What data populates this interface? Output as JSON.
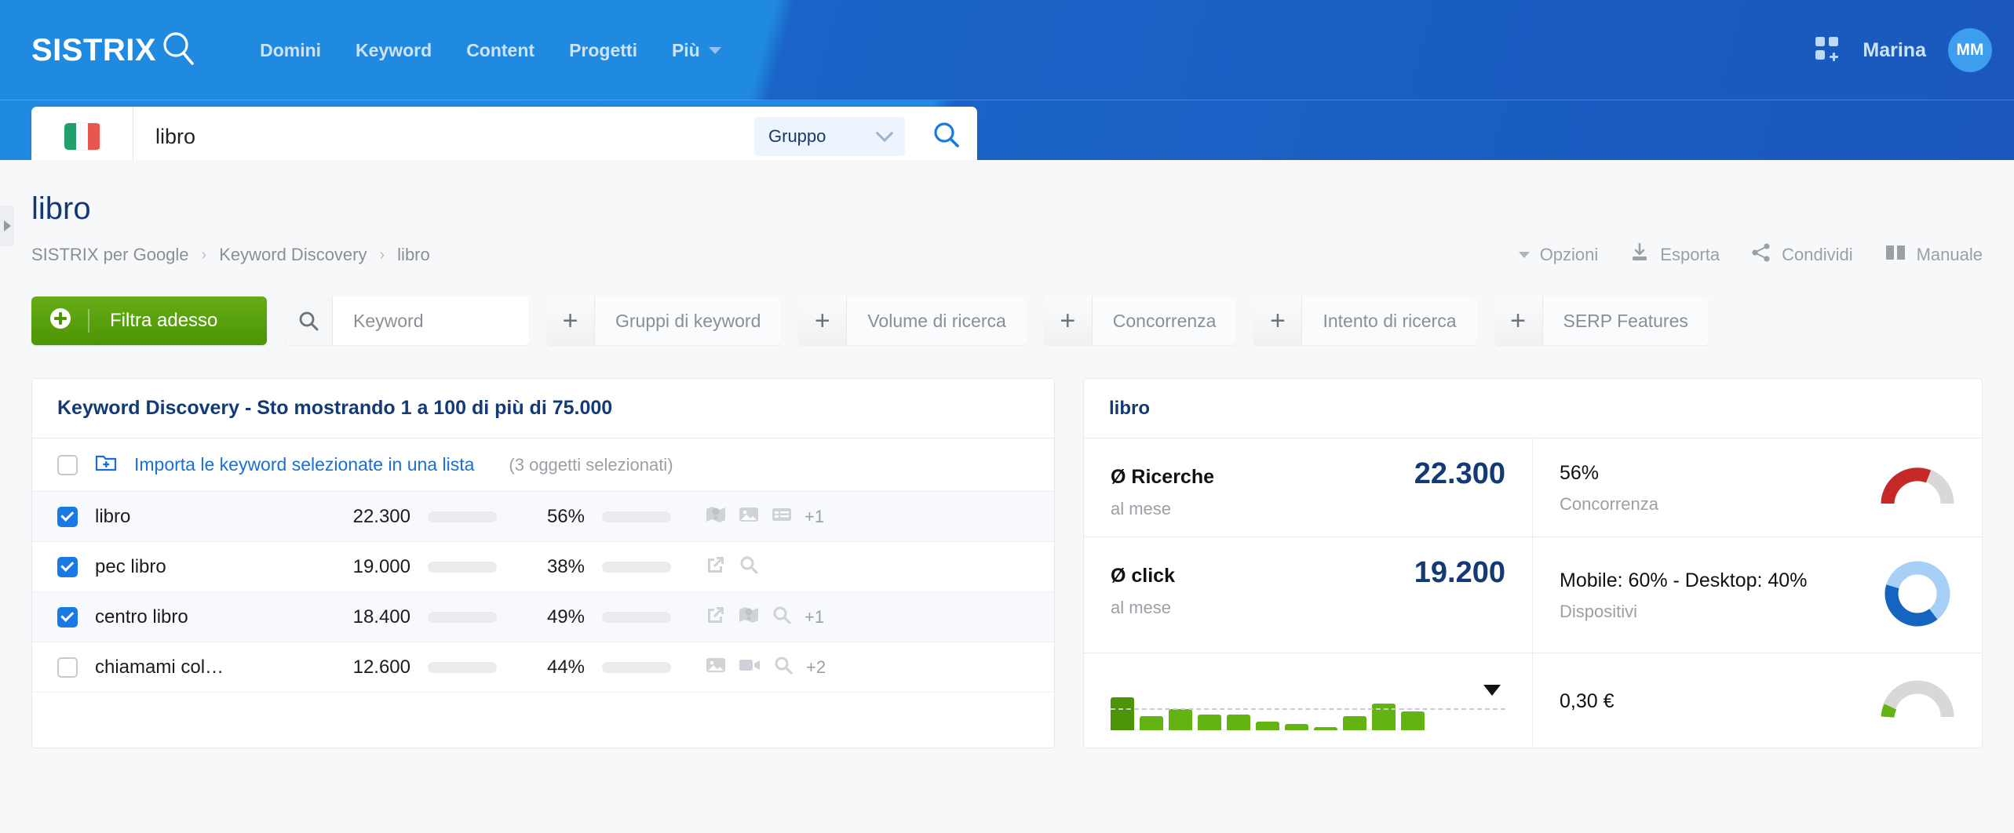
{
  "brand": {
    "name": "SISTRIX",
    "logo_icon": "magnifier-icon"
  },
  "nav": {
    "items": [
      {
        "label": "Domini"
      },
      {
        "label": "Keyword"
      },
      {
        "label": "Content"
      },
      {
        "label": "Progetti"
      },
      {
        "label": "Più",
        "has_caret": true
      }
    ]
  },
  "header_right": {
    "apps_icon": "apps-grid-plus-icon",
    "user_name": "Marina",
    "avatar_initials": "MM"
  },
  "search": {
    "country_flag": "italy-flag-icon",
    "value": "libro",
    "placeholder": "",
    "group_label": "Gruppo",
    "submit_icon": "search-icon"
  },
  "page": {
    "title": "libro",
    "breadcrumb": [
      {
        "label": "SISTRIX per Google"
      },
      {
        "label": "Keyword Discovery"
      },
      {
        "label": "libro"
      }
    ],
    "separator": "›",
    "actions": [
      {
        "label": "Opzioni",
        "icon": "caret-down-icon"
      },
      {
        "label": "Esporta",
        "icon": "download-icon"
      },
      {
        "label": "Condividi",
        "icon": "share-icon"
      },
      {
        "label": "Manuale",
        "icon": "book-icon"
      }
    ]
  },
  "filters": {
    "primary_button": {
      "label": "Filtra adesso",
      "icon": "plus-circle-icon"
    },
    "keyword_input": {
      "placeholder": "Keyword",
      "icon": "search-icon",
      "value": ""
    },
    "chips": [
      {
        "label": "Gruppi di keyword",
        "icon": "plus-icon"
      },
      {
        "label": "Volume di ricerca",
        "icon": "plus-icon"
      },
      {
        "label": "Concorrenza",
        "icon": "plus-icon"
      },
      {
        "label": "Intento di ricerca",
        "icon": "plus-icon"
      },
      {
        "label": "SERP Features",
        "icon": "plus-icon"
      }
    ]
  },
  "results": {
    "title": "Keyword Discovery - Sto mostrando 1 a 100 di più di 75.000",
    "import_link": "Importa le keyword selezionate in una lista",
    "import_icon": "folder-add-icon",
    "selected_count": "(3 oggetti selezionati)",
    "rows": [
      {
        "keyword": "libro",
        "volume": "22.300",
        "volume_pct": 62,
        "competition": "56%",
        "competition_pct": 56,
        "serp_icons": [
          "map-pin-icon",
          "image-icon",
          "table-icon"
        ],
        "more": "+1",
        "checked": true
      },
      {
        "keyword": "pec libro",
        "volume": "19.000",
        "volume_pct": 58,
        "competition": "38%",
        "competition_pct": 38,
        "serp_icons": [
          "external-link-icon",
          "search-icon"
        ],
        "more": "",
        "checked": true
      },
      {
        "keyword": "centro libro",
        "volume": "18.400",
        "volume_pct": 60,
        "competition": "49%",
        "competition_pct": 49,
        "serp_icons": [
          "external-link-icon",
          "map-pin-icon",
          "search-icon"
        ],
        "more": "+1",
        "checked": true
      },
      {
        "keyword": "chiamami col…",
        "volume": "12.600",
        "volume_pct": 56,
        "competition": "44%",
        "competition_pct": 44,
        "serp_icons": [
          "image-icon",
          "video-icon",
          "search-icon"
        ],
        "more": "+2",
        "checked": false
      }
    ]
  },
  "detail": {
    "title": "libro",
    "metrics": [
      {
        "label": "Ø Ricerche",
        "value": "22.300",
        "sub": "al mese",
        "right_main": "56%",
        "right_sub": "Concorrenza",
        "gauge": {
          "type": "half-donut",
          "value": 56,
          "color": "#c62828",
          "track": "#d8d8d8"
        }
      },
      {
        "label": "Ø click",
        "value": "19.200",
        "sub": "al mese",
        "right_main": "Mobile: 60% - Desktop: 40%",
        "right_sub": "Dispositivi",
        "gauge": {
          "type": "donut",
          "value": 60,
          "color": "#a8d0f7",
          "color2": "#1565c0"
        }
      },
      {
        "label": "",
        "value": "",
        "sub": "",
        "right_main": "0,30 €",
        "right_sub": "",
        "gauge": {
          "type": "half-donut",
          "value": 12,
          "color": "#63b412",
          "track": "#d8d8d8"
        }
      }
    ],
    "trend_bars": [
      62,
      26,
      40,
      30,
      30,
      16,
      12,
      6,
      26,
      50,
      36
    ]
  },
  "colors": {
    "brand_blue": "#1a6fd4",
    "navy": "#133a74",
    "green": "#63b412",
    "red": "#cf1f36"
  }
}
